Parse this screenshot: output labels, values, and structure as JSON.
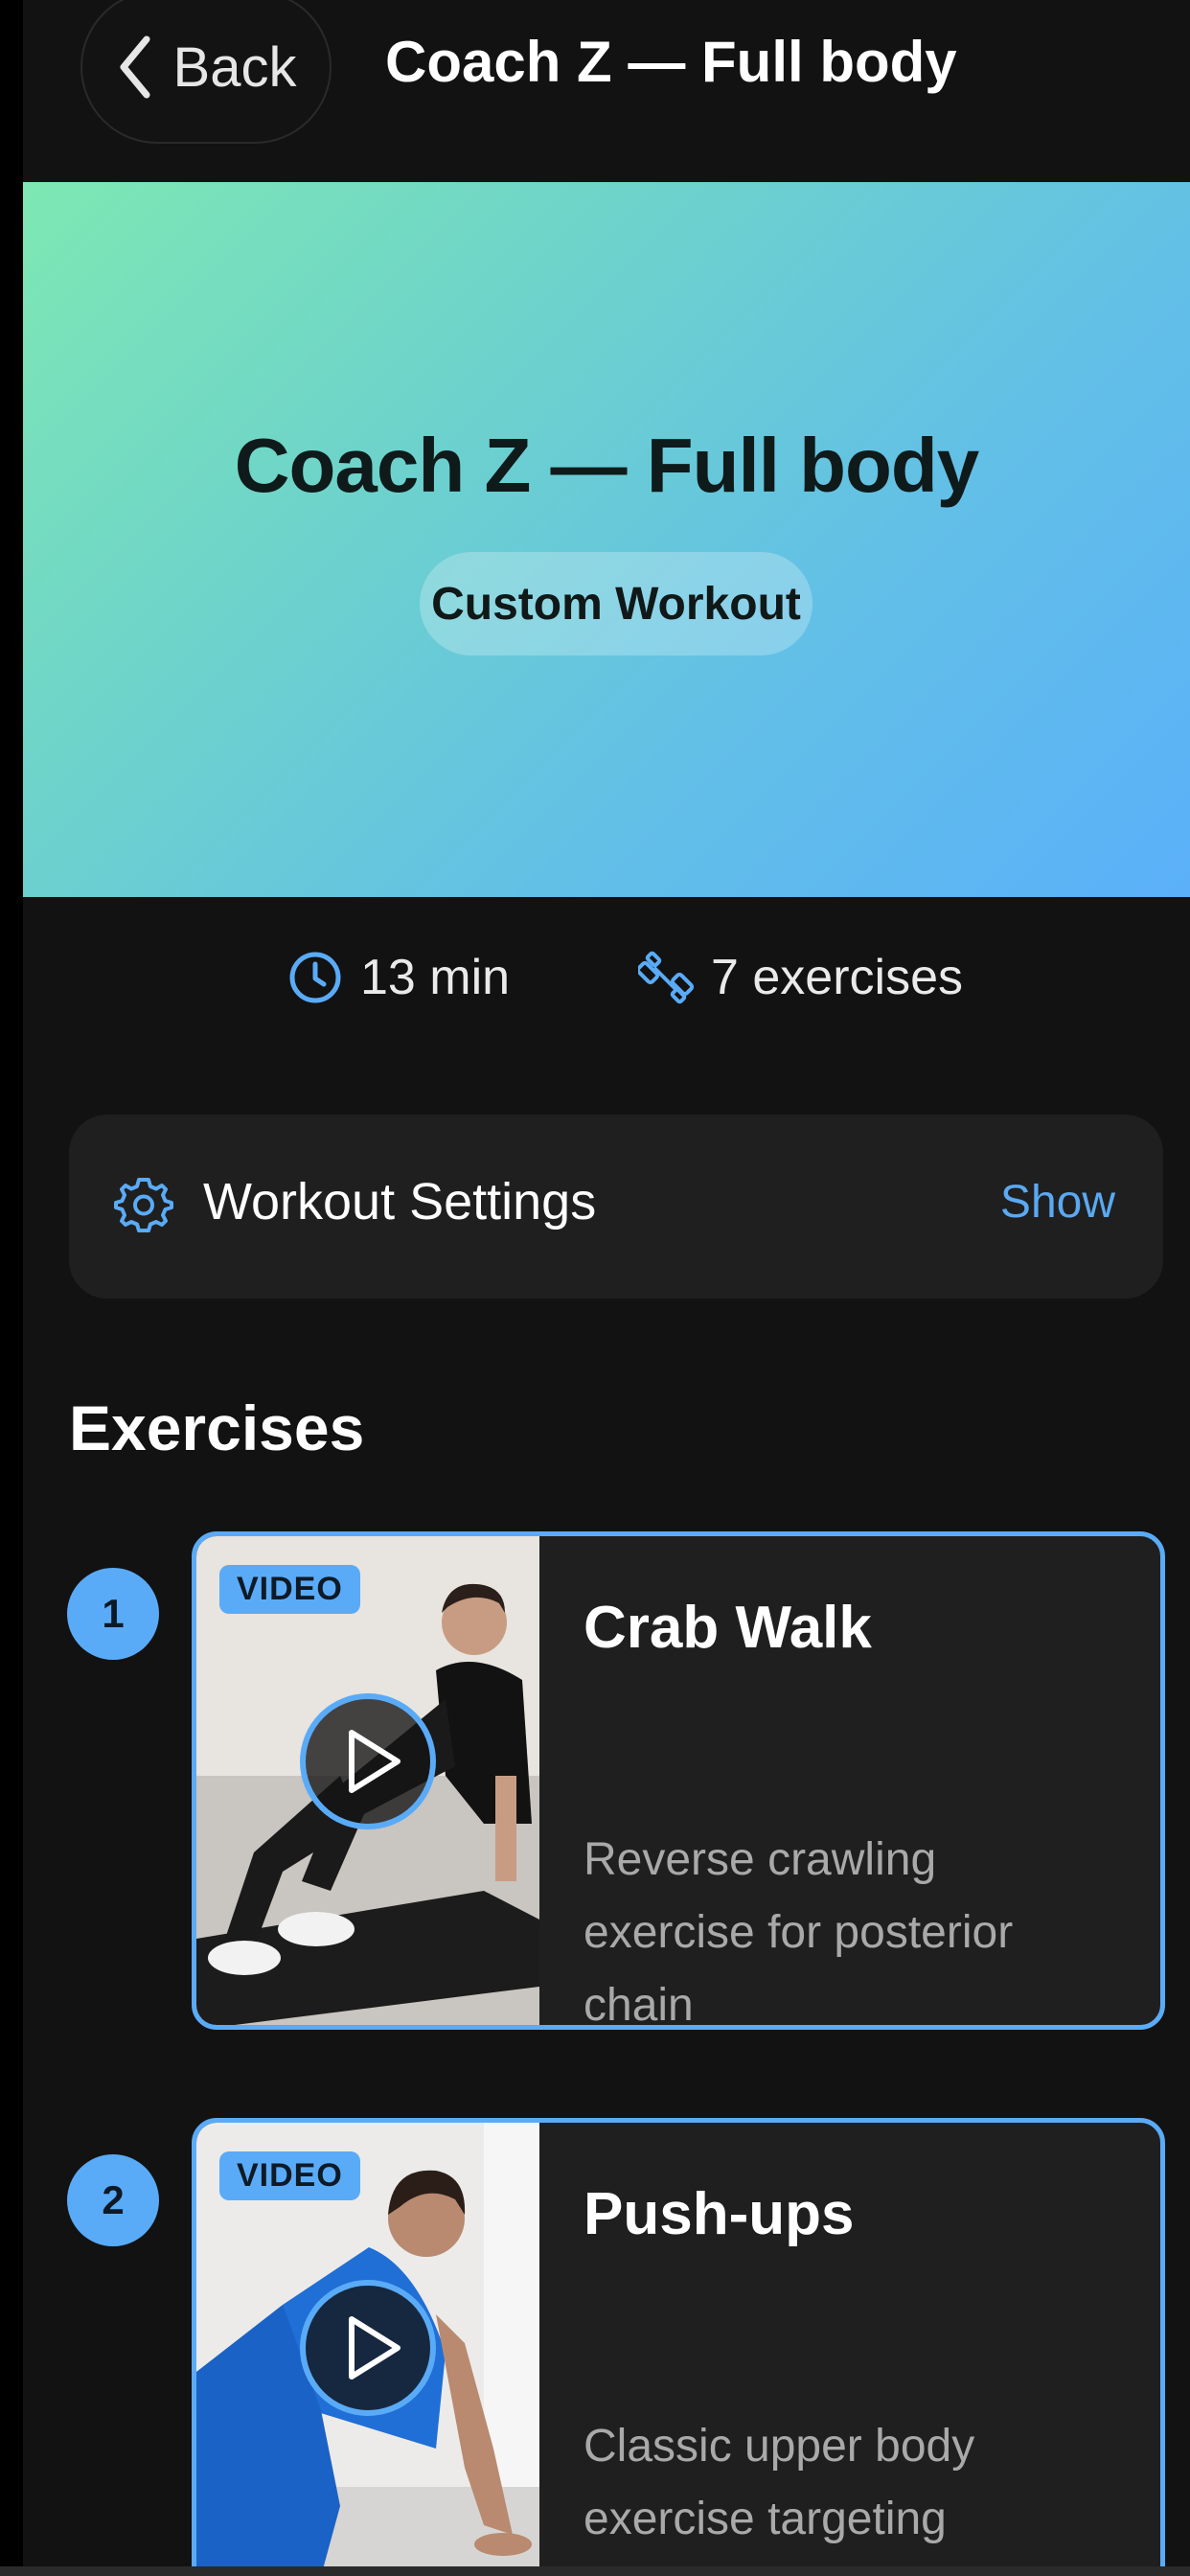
{
  "header": {
    "back_label": "Back",
    "title": "Coach Z — Full body"
  },
  "hero": {
    "title": "Coach Z — Full body",
    "badge": "Custom Workout",
    "gradient_start": "#7ee8b3",
    "gradient_end": "#5bb0f9"
  },
  "stats": {
    "duration": "13 min",
    "duration_icon": "clock-icon",
    "exercises": "7 exercises",
    "exercises_icon": "dumbbell-icon"
  },
  "settings": {
    "label": "Workout Settings",
    "action": "Show",
    "icon": "gear-icon"
  },
  "section": {
    "title": "Exercises"
  },
  "exercises": [
    {
      "number": "1",
      "badge": "VIDEO",
      "name": "Crab Walk",
      "description": "Reverse crawling exercise for posterior chain"
    },
    {
      "number": "2",
      "badge": "VIDEO",
      "name": "Push-ups",
      "description": "Classic upper body exercise targeting chest,..."
    }
  ],
  "colors": {
    "accent": "#5aabf7",
    "background": "#121212",
    "card": "#1f1f1f"
  }
}
